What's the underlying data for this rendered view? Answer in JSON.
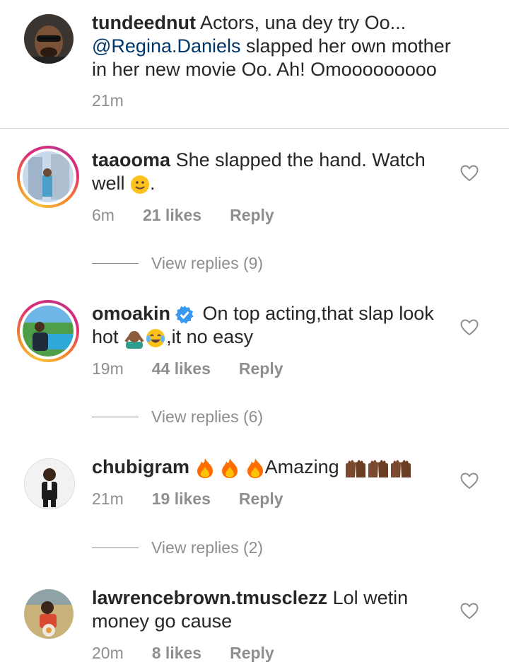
{
  "caption": {
    "username": "tundeednut",
    "text_1": "Actors, una dey try Oo...",
    "mention": "@Regina.Daniels",
    "text_2": " slapped her own mother",
    "text_3": "in her new movie Oo. Ah! Omooooooooo",
    "time": "21m"
  },
  "comments": [
    {
      "username": "taaooma",
      "line1": "She slapped the hand. Watch",
      "line2": "well",
      "line2_suffix": ".",
      "time": "6m",
      "likes": "21 likes",
      "reply": "Reply",
      "view_replies": "View replies (9)"
    },
    {
      "username": "omoakin",
      "line1": "On top acting,that slap look",
      "line2": "hot",
      "line2_suffix": ",it no easy",
      "time": "19m",
      "likes": "44 likes",
      "reply": "Reply",
      "view_replies": "View replies (6)"
    },
    {
      "username": "chubigram",
      "line1": "Amazing",
      "time": "21m",
      "likes": "19 likes",
      "reply": "Reply",
      "view_replies": "View replies (2)"
    },
    {
      "username": "lawrencebrown.tmusclezz",
      "line1": "Lol wetin",
      "line2": "money go cause",
      "time": "20m",
      "likes": "8 likes",
      "reply": "Reply"
    }
  ],
  "icons": {
    "heart": "heart-outline-icon",
    "verified": "verified-badge-icon",
    "fire": "fire-emoji",
    "smile": "slight-smile-emoji",
    "raised_hands": "raised-hands-emoji",
    "facepalm": "man-gesturing-no-emoji",
    "laugh": "tears-of-joy-emoji"
  },
  "colors": {
    "username": "#262626",
    "mention": "#00376b",
    "meta": "#8e8e8e",
    "verified": "#3897f0"
  }
}
